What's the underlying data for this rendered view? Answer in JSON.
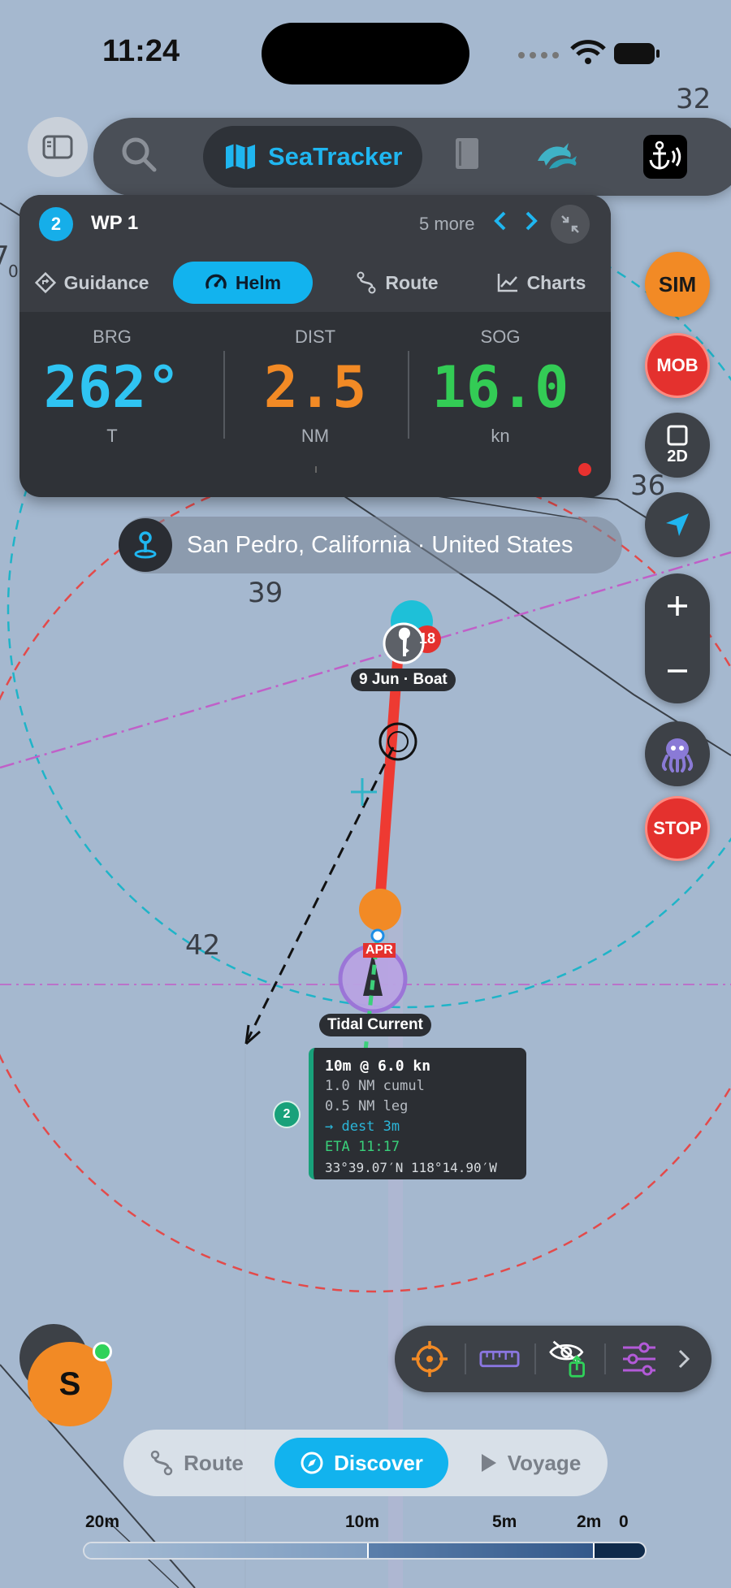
{
  "status_bar": {
    "time": "11:24"
  },
  "toolbar": {
    "brand": "SeaTracker",
    "icons": [
      "sidebar-icon",
      "search-icon",
      "map-icon",
      "book-icon",
      "dolphins-icon",
      "anchor-alarm-icon"
    ]
  },
  "guidance_panel": {
    "waypoint_number": "2",
    "waypoint_name": "WP 1",
    "more_label": "5 more",
    "tabs": [
      {
        "label": "Guidance",
        "icon": "diamond-arrow-icon"
      },
      {
        "label": "Helm",
        "icon": "gauge-icon"
      },
      {
        "label": "Route",
        "icon": "route-icon"
      },
      {
        "label": "Charts",
        "icon": "chart-line-icon"
      }
    ],
    "active_tab": "Helm",
    "metrics": [
      {
        "label": "BRG",
        "value": "262°",
        "unit": "T",
        "color": "#2fc4f2"
      },
      {
        "label": "DIST",
        "value": "2.5",
        "unit": "NM",
        "color": "#f28a25"
      },
      {
        "label": "SOG",
        "value": "16.0",
        "unit": "kn",
        "color": "#33cc55"
      }
    ]
  },
  "location": {
    "text": "San Pedro, California · United States"
  },
  "right_controls": {
    "sim": "SIM",
    "mob": "MOB",
    "view_mode": "2D",
    "stop": "STOP"
  },
  "map": {
    "depth_labels": [
      "32",
      "36",
      "39",
      "42",
      "7",
      "0"
    ],
    "boat_label": "9 Jun · Boat",
    "boat_badge": "18",
    "current_label": "Tidal Current",
    "apr_tag": "APR",
    "waypoint_badge": "2",
    "leg_info": {
      "line1": "10m @ 6.0 kn",
      "line2": "1.0 NM cumul",
      "line3": "0.5 NM leg",
      "line4": "→ dest  3m",
      "line5": "ETA 11:17",
      "line6": "33°39.07′N 118°14.90′W"
    }
  },
  "user": {
    "initial": "S",
    "online": true
  },
  "map_tools": [
    "crosshair-icon",
    "ruler-icon",
    "visibility-share-icon",
    "sliders-icon",
    "chevron-right-icon"
  ],
  "bottom_tabs": [
    {
      "label": "Route",
      "icon": "route-icon"
    },
    {
      "label": "Discover",
      "icon": "compass-icon"
    },
    {
      "label": "Voyage",
      "icon": "play-icon"
    }
  ],
  "active_bottom_tab": "Discover",
  "depth_scale": {
    "labels": [
      "20m",
      "10m",
      "5m",
      "2m",
      "0"
    ]
  }
}
